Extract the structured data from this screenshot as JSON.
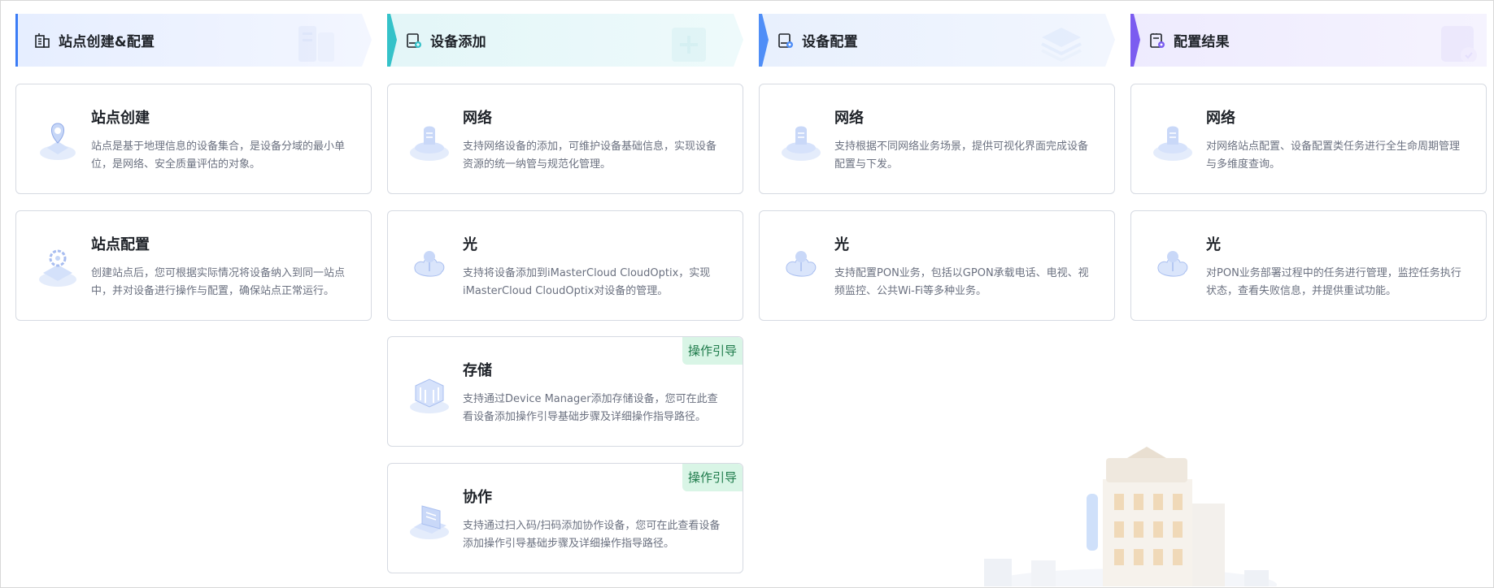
{
  "columns": [
    {
      "title": "站点创建&配置",
      "accent": "#3b7cf6",
      "bg": "#eef3ff",
      "icon": "building-icon",
      "cards": [
        {
          "title": "站点创建",
          "desc": "站点是基于地理信息的设备集合，是设备分域的最小单位，是网络、安全质量评估的对象。",
          "illus": "site-create-illustration"
        },
        {
          "title": "站点配置",
          "desc": "创建站点后，您可根据实际情况将设备纳入到同一站点中，并对设备进行操作与配置，确保站点正常运行。",
          "illus": "site-config-illustration"
        }
      ]
    },
    {
      "title": "设备添加",
      "accent": "#35c2c9",
      "bg": "#e9f8fa",
      "icon": "device-add-icon",
      "cards": [
        {
          "title": "网络",
          "desc": "支持网络设备的添加，可维护设备基础信息，实现设备资源的统一纳管与规范化管理。",
          "illus": "network-illustration"
        },
        {
          "title": "光",
          "desc": "支持将设备添加到iMasterCloud CloudOptix，实现iMasterCloud CloudOptix对设备的管理。",
          "illus": "optical-illustration"
        },
        {
          "title": "存储",
          "desc": "支持通过Device Manager添加存储设备，您可在此查看设备添加操作引导基础步骤及详细操作指导路径。",
          "illus": "storage-illustration",
          "badge": "操作引导"
        },
        {
          "title": "协作",
          "desc": "支持通过扫入码/扫码添加协作设备，您可在此查看设备添加操作引导基础步骤及详细操作指导路径。",
          "illus": "collaboration-illustration",
          "badge": "操作引导"
        }
      ]
    },
    {
      "title": "设备配置",
      "accent": "#4f8ef7",
      "bg": "#edf3fd",
      "icon": "device-config-icon",
      "cards": [
        {
          "title": "网络",
          "desc": "支持根据不同网络业务场景，提供可视化界面完成设备配置与下发。",
          "illus": "network-illustration"
        },
        {
          "title": "光",
          "desc": "支持配置PON业务，包括以GPON承载电话、电视、视频监控、公共Wi-Fi等多种业务。",
          "illus": "optical-illustration"
        }
      ]
    },
    {
      "title": "配置结果",
      "accent": "#7b5cf0",
      "bg": "#f1eefe",
      "icon": "config-result-icon",
      "cards": [
        {
          "title": "网络",
          "desc": "对网络站点配置、设备配置类任务进行全生命周期管理与多维度查询。",
          "illus": "network-illustration"
        },
        {
          "title": "光",
          "desc": "对PON业务部署过程中的任务进行管理，监控任务执行状态，查看失败信息，并提供重试功能。",
          "illus": "optical-illustration"
        }
      ]
    }
  ]
}
